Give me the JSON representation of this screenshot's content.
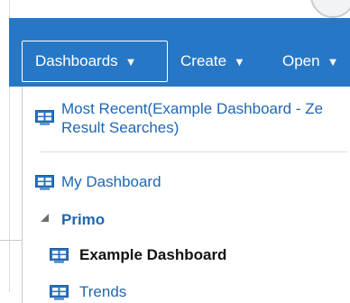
{
  "navbar": {
    "dashboards_label": "Dashboards",
    "create_label": "Create",
    "open_label": "Open"
  },
  "dropdown": {
    "most_recent_line1": "Most Recent(Example Dashboard - Ze",
    "most_recent_line2": "Result Searches)",
    "my_dashboard_label": "My Dashboard",
    "group_label": "Primo",
    "group_items": [
      {
        "label": "Example Dashboard",
        "selected": true
      },
      {
        "label": "Trends",
        "selected": false
      }
    ]
  },
  "icons": {
    "dashboard": "dashboard-icon",
    "caret": "caret-down-icon",
    "expanded": "expanded-triangle-icon"
  },
  "colors": {
    "nav_bg": "#2678c7",
    "link": "#1f66b3",
    "icon_blue": "#2a73c4"
  }
}
